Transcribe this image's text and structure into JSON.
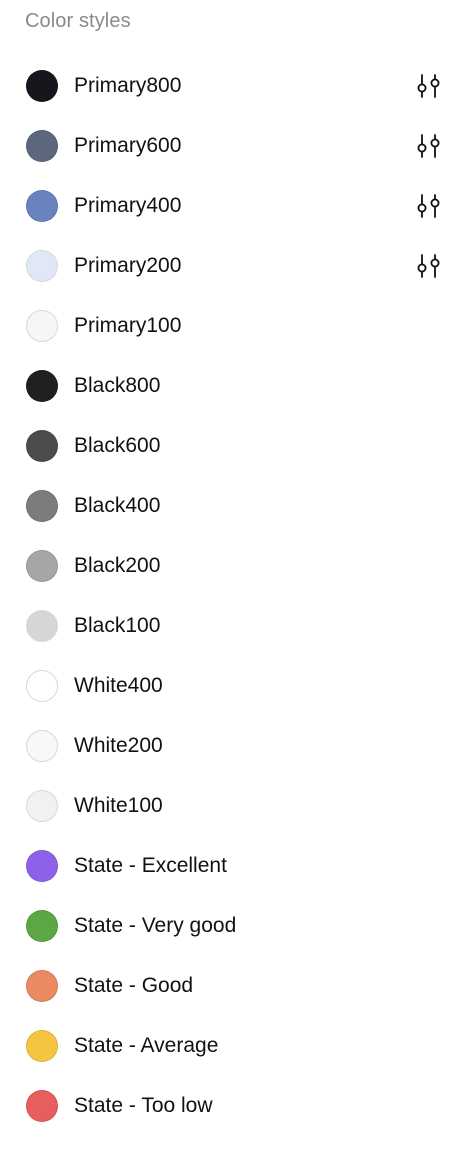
{
  "panel": {
    "title": "Color styles"
  },
  "styles": [
    {
      "name": "Primary800",
      "color": "#15171c",
      "has_adjust": true,
      "light": false
    },
    {
      "name": "Primary600",
      "color": "#5d687c",
      "has_adjust": true,
      "light": false
    },
    {
      "name": "Primary400",
      "color": "#6a82c0",
      "has_adjust": true,
      "light": false
    },
    {
      "name": "Primary200",
      "color": "#e1e7f6",
      "has_adjust": true,
      "light": true
    },
    {
      "name": "Primary100",
      "color": "#f5f6f6",
      "has_adjust": false,
      "light": true
    },
    {
      "name": "Black800",
      "color": "#202020",
      "has_adjust": false,
      "light": false
    },
    {
      "name": "Black600",
      "color": "#4c4c4c",
      "has_adjust": false,
      "light": false
    },
    {
      "name": "Black400",
      "color": "#7c7c7c",
      "has_adjust": false,
      "light": false
    },
    {
      "name": "Black200",
      "color": "#a6a6a6",
      "has_adjust": false,
      "light": false
    },
    {
      "name": "Black100",
      "color": "#d6d6d6",
      "has_adjust": false,
      "light": true
    },
    {
      "name": "White400",
      "color": "#ffffff",
      "has_adjust": false,
      "light": true
    },
    {
      "name": "White200",
      "color": "#f7f8f8",
      "has_adjust": false,
      "light": true
    },
    {
      "name": "White100",
      "color": "#f0f1f1",
      "has_adjust": false,
      "light": true
    },
    {
      "name": "State - Excellent",
      "color": "#8e62e8",
      "has_adjust": false,
      "light": false
    },
    {
      "name": "State - Very good",
      "color": "#5aa744",
      "has_adjust": false,
      "light": false
    },
    {
      "name": "State - Good",
      "color": "#e98a62",
      "has_adjust": false,
      "light": false
    },
    {
      "name": "State - Average",
      "color": "#f5c542",
      "has_adjust": false,
      "light": false
    },
    {
      "name": "State - Too low",
      "color": "#e75f5d",
      "has_adjust": false,
      "light": false
    }
  ],
  "icons": {
    "adjust": "adjust-style-icon"
  }
}
